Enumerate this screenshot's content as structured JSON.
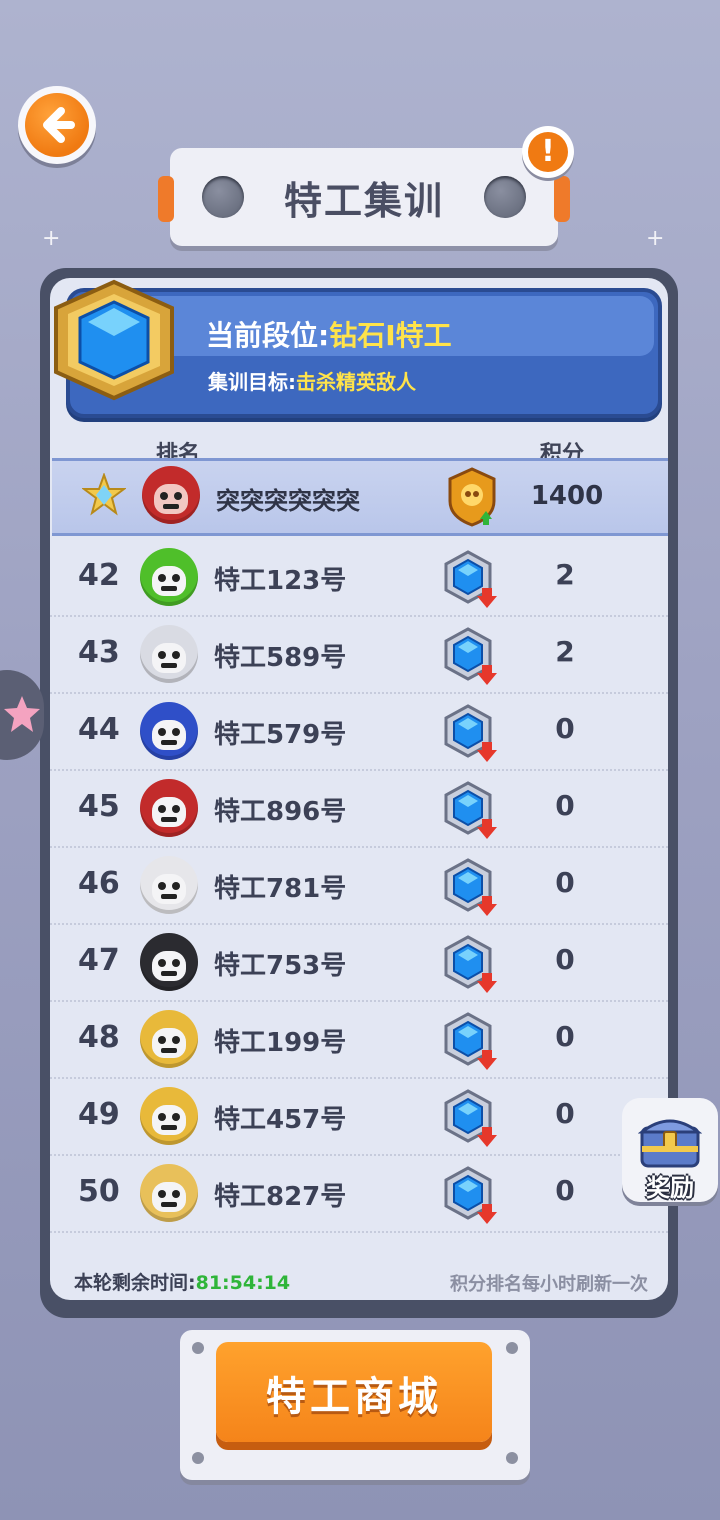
{
  "header": {
    "title": "特工集训",
    "back_icon": "arrow-left-icon",
    "info_icon": "exclamation-icon"
  },
  "rank_panel": {
    "current_rank_label": "当前段位:",
    "current_rank_value": "钻石I特工",
    "goal_label": "集训目标:",
    "goal_value": "击杀精英敌人"
  },
  "table": {
    "col_rank": "排名",
    "col_score": "积分",
    "my_row": {
      "name": "突突突突突突",
      "score": "1400",
      "trend": "up"
    },
    "rows": [
      {
        "rank": "42",
        "name": "特工123号",
        "score": "2",
        "avatar_color": "#4fbf2a",
        "trend": "down"
      },
      {
        "rank": "43",
        "name": "特工589号",
        "score": "2",
        "avatar_color": "#d9dbe3",
        "trend": "down"
      },
      {
        "rank": "44",
        "name": "特工579号",
        "score": "0",
        "avatar_color": "#2f4fc8",
        "trend": "down"
      },
      {
        "rank": "45",
        "name": "特工896号",
        "score": "0",
        "avatar_color": "#c22b2b",
        "trend": "down"
      },
      {
        "rank": "46",
        "name": "特工781号",
        "score": "0",
        "avatar_color": "#e6e6ea",
        "trend": "down"
      },
      {
        "rank": "47",
        "name": "特工753号",
        "score": "0",
        "avatar_color": "#2b2b30",
        "trend": "down"
      },
      {
        "rank": "48",
        "name": "特工199号",
        "score": "0",
        "avatar_color": "#e8b93a",
        "trend": "down"
      },
      {
        "rank": "49",
        "name": "特工457号",
        "score": "0",
        "avatar_color": "#e8b93a",
        "trend": "down"
      },
      {
        "rank": "50",
        "name": "特工827号",
        "score": "0",
        "avatar_color": "#e8c05a",
        "trend": "down"
      }
    ]
  },
  "footer": {
    "time_label": "本轮剩余时间:",
    "time_value": "81:54:14",
    "refresh_note": "积分排名每小时刷新一次"
  },
  "reward": {
    "label": "奖励",
    "icon": "treasure-chest-icon"
  },
  "shop": {
    "label": "特工商城"
  },
  "colors": {
    "accent_orange": "#f5841a",
    "rank_blue": "#3d68bf",
    "highlight_yellow": "#ffe34a",
    "timer_green": "#2fb53a"
  }
}
